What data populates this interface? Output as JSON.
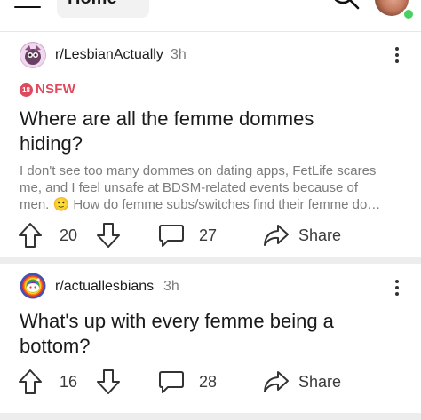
{
  "header": {
    "feed_label": "Home"
  },
  "posts": [
    {
      "subreddit": "r/LesbianActually",
      "age": "3h",
      "nsfw_badge": "18",
      "nsfw_label": "NSFW",
      "title_line1": "Where are all the femme dommes",
      "title_line2": "hiding?",
      "body_line1": "I don't see too many dommes on dating apps, FetLife scares",
      "body_line2": "me, and I feel unsafe at BDSM-related events because of",
      "body_line3": "men. 🙂 How do femme subs/switches find their femme do…",
      "votes": "20",
      "comments": "27",
      "share_label": "Share"
    },
    {
      "subreddit": "r/actuallesbians",
      "age": "3h",
      "title_line1": "What's up with every femme being a",
      "title_line2": "bottom?",
      "votes": "16",
      "comments": "28",
      "share_label": "Share"
    }
  ],
  "icons": {
    "menu": "hamburger-menu-icon",
    "dropdown": "chevron-down-icon",
    "search": "search-icon",
    "more": "kebab-menu-icon",
    "upvote": "upvote-arrow-icon",
    "downvote": "downvote-arrow-icon",
    "comment": "comment-bubble-icon",
    "share": "share-arrow-icon"
  },
  "colors": {
    "nsfw": "#e0485c",
    "online": "#46d160",
    "muted_text": "#7c7c7c",
    "divider": "#ededed"
  }
}
